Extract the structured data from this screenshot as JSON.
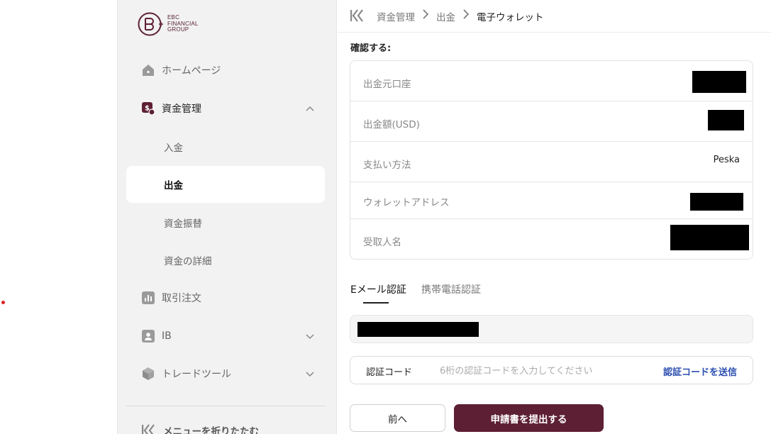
{
  "brand": {
    "name_lines": [
      "EBC",
      "FINANCIAL",
      "GROUP"
    ],
    "color": "#5d1f33"
  },
  "sidebar": {
    "items": [
      {
        "label": "ホームページ",
        "icon": "home-icon"
      },
      {
        "label": "資金管理",
        "icon": "dollar-icon",
        "expanded": true
      },
      {
        "label": "入金"
      },
      {
        "label": "出金",
        "active": true
      },
      {
        "label": "資金振替"
      },
      {
        "label": "資金の詳細"
      },
      {
        "label": "取引注文",
        "icon": "chart-icon"
      },
      {
        "label": "IB",
        "icon": "user-card-icon"
      },
      {
        "label": "トレードツール",
        "icon": "cube-icon"
      }
    ],
    "collapse_label": "メニューを折りたたむ"
  },
  "breadcrumb": {
    "items": [
      "資金管理",
      "出金",
      "電子ウォレット"
    ]
  },
  "confirm": {
    "title": "確認する:",
    "rows": [
      {
        "label": "出金元口座",
        "value": ""
      },
      {
        "label": "出金額(USD)",
        "value": ""
      },
      {
        "label": "支払い方法",
        "value": "Peska"
      },
      {
        "label": "ウォレットアドレス",
        "value": ""
      },
      {
        "label": "受取人名",
        "value": ""
      }
    ]
  },
  "verification": {
    "tabs": [
      {
        "label": "Eメール認証",
        "active": true
      },
      {
        "label": "携帯電話認証",
        "active": false
      }
    ],
    "code_label": "認証コード",
    "code_placeholder": "6桁の認証コードを入力してください",
    "send_code_label": "認証コードを送信"
  },
  "actions": {
    "prev_label": "前へ",
    "submit_label": "申請書を提出する"
  },
  "colors": {
    "accent": "#5d1f33",
    "link": "#2c4fb0",
    "sidebar_bg": "#f2f2f3"
  }
}
